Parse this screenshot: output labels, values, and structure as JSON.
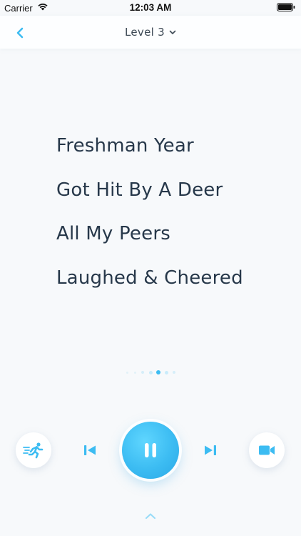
{
  "status_bar": {
    "carrier": "Carrier",
    "time": "12:03 AM"
  },
  "header": {
    "back_icon": "chevron-left-icon",
    "level_label": "Level 3",
    "dropdown_icon": "chevron-down-icon"
  },
  "lyrics": [
    "Freshman Year",
    "Got Hit By A Deer",
    "All My Peers",
    "Laughed & Cheered"
  ],
  "pagination": {
    "total": 7,
    "current": 5
  },
  "controls": {
    "speed_icon": "running-person-icon",
    "previous_icon": "skip-previous-icon",
    "play_pause_icon": "pause-icon",
    "next_icon": "skip-next-icon",
    "video_icon": "video-camera-icon"
  },
  "footer": {
    "expand_icon": "chevron-up-icon"
  },
  "colors": {
    "accent": "#3cbcf2",
    "text": "#27384a",
    "background": "#f7f9fb"
  }
}
